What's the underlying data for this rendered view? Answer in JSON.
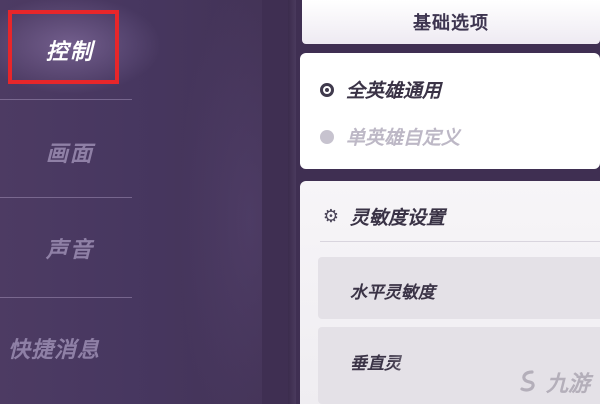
{
  "sidebar": {
    "items": [
      {
        "label": "控制",
        "active": true
      },
      {
        "label": "画面",
        "active": false
      },
      {
        "label": "声音",
        "active": false
      },
      {
        "label": "快捷消息",
        "active": false
      }
    ],
    "highlight_color": "#e8262a"
  },
  "tabs": {
    "basic": "基础选项"
  },
  "mode": {
    "options": [
      {
        "label": "全英雄通用",
        "selected": true
      },
      {
        "label": "单英雄自定义",
        "selected": false
      }
    ]
  },
  "sensitivity": {
    "icon": "gear-icon",
    "title": "灵敏度设置",
    "horizontal_label": "水平灵敏度",
    "vertical_label": "垂直灵"
  },
  "watermark": {
    "text": "九游"
  },
  "colors": {
    "sidebar_bg": "#4a3a5e",
    "active_text": "#ffffff",
    "inactive_text": "#8f80a6",
    "card_bg": "#ffffff"
  }
}
